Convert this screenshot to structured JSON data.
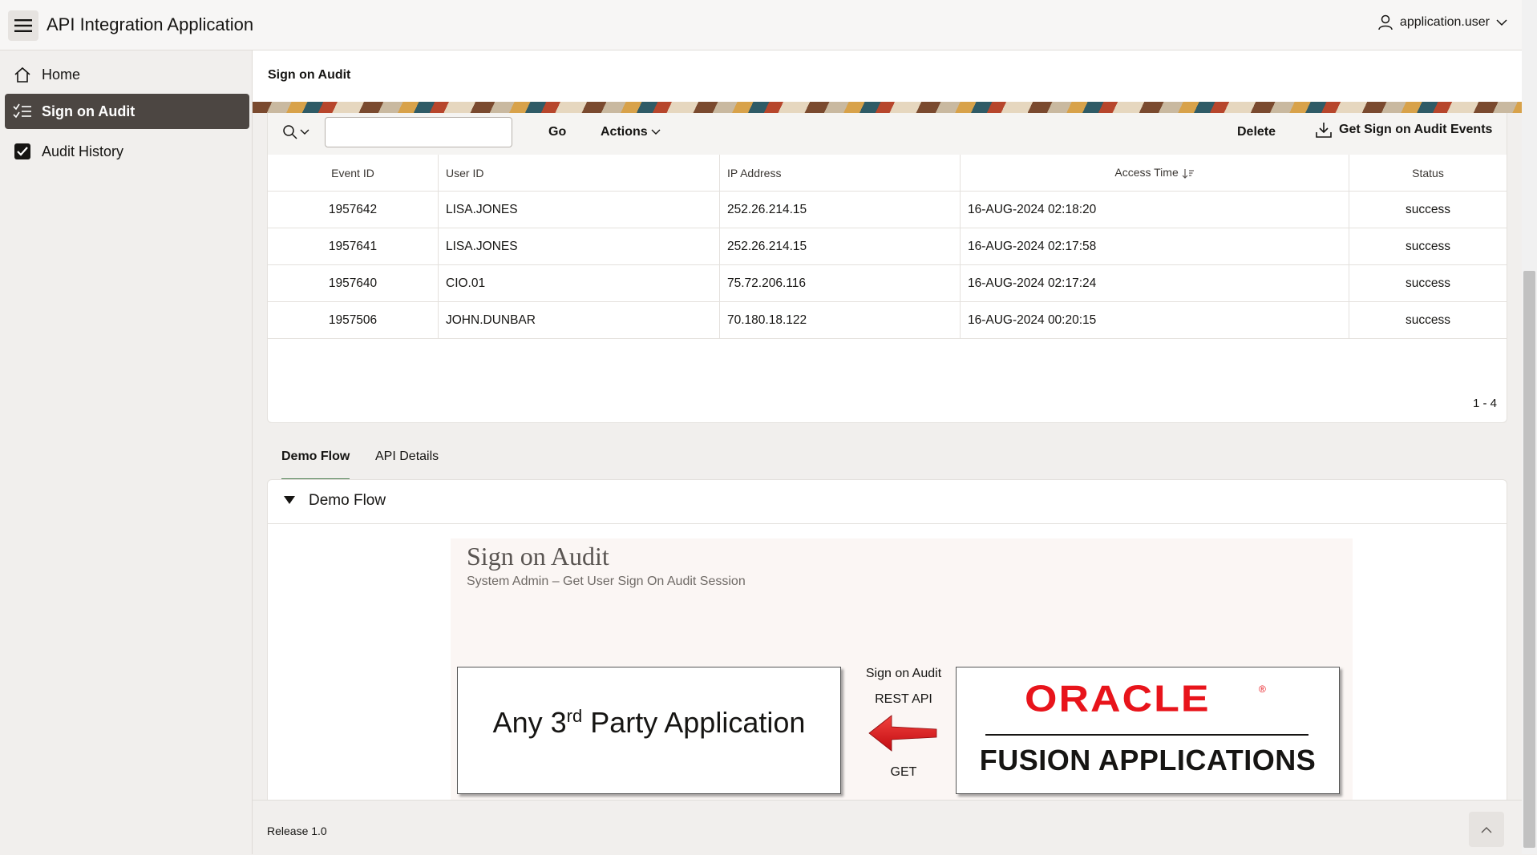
{
  "header": {
    "app_title": "API Integration Application",
    "user_name": "application.user"
  },
  "sidebar": {
    "items": [
      {
        "label": "Home",
        "icon": "home-icon",
        "active": false
      },
      {
        "label": "Sign on Audit",
        "icon": "checklist-icon",
        "active": true
      },
      {
        "label": "Audit History",
        "icon": "checkbox-icon",
        "active": false
      }
    ]
  },
  "page": {
    "title": "Sign on Audit"
  },
  "toolbar": {
    "search_value": "",
    "go_label": "Go",
    "actions_label": "Actions",
    "delete_label": "Delete",
    "get_events_label": "Get Sign on Audit Events"
  },
  "table": {
    "columns": [
      "Event ID",
      "User ID",
      "IP Address",
      "Access Time",
      "Status"
    ],
    "rows": [
      {
        "event_id": "1957642",
        "user_id": "LISA.JONES",
        "ip": "252.26.214.15",
        "access_time": "16-AUG-2024 02:18:20",
        "status": "success"
      },
      {
        "event_id": "1957641",
        "user_id": "LISA.JONES",
        "ip": "252.26.214.15",
        "access_time": "16-AUG-2024 02:17:58",
        "status": "success"
      },
      {
        "event_id": "1957640",
        "user_id": "CIO.01",
        "ip": "75.72.206.116",
        "access_time": "16-AUG-2024 02:17:24",
        "status": "success"
      },
      {
        "event_id": "1957506",
        "user_id": "JOHN.DUNBAR",
        "ip": "70.180.18.122",
        "access_time": "16-AUG-2024 00:20:15",
        "status": "success"
      }
    ],
    "pagination": "1 - 4"
  },
  "tabs": {
    "items": [
      {
        "label": "Demo Flow",
        "active": true
      },
      {
        "label": "API Details",
        "active": false
      }
    ]
  },
  "region": {
    "title": "Demo Flow"
  },
  "diagram": {
    "title": "Sign on Audit",
    "subtitle": "System Admin – Get User Sign On Audit Session",
    "left_box_prefix": "Any 3",
    "left_box_sup": "rd",
    "left_box_suffix": " Party Application",
    "mid_label_1": "Sign on Audit",
    "mid_label_2": "REST API",
    "mid_label_3": "GET",
    "oracle_logo_text": "ORACLE",
    "registered_mark": "®",
    "fusion_text": "FUSION APPLICATIONS",
    "arrow_color": "#e8141b",
    "oracle_red": "#e8141b"
  },
  "footer": {
    "release": "Release 1.0"
  }
}
